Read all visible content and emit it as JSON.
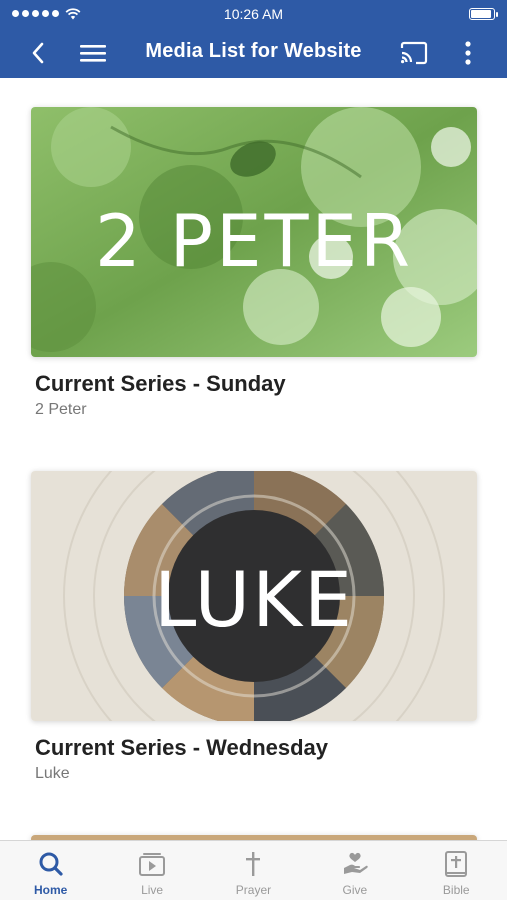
{
  "status": {
    "time": "10:26 AM"
  },
  "header": {
    "title": "Media List for Website"
  },
  "cards": [
    {
      "art_text": "2 PETER",
      "title": "Current Series - Sunday",
      "subtitle": "2 Peter"
    },
    {
      "art_text": "LUKE",
      "title": "Current Series - Wednesday",
      "subtitle": "Luke"
    }
  ],
  "tabs": [
    {
      "label": "Home",
      "icon": "search-icon",
      "active": true
    },
    {
      "label": "Live",
      "icon": "play-video-icon",
      "active": false
    },
    {
      "label": "Prayer",
      "icon": "cross-icon",
      "active": false
    },
    {
      "label": "Give",
      "icon": "giving-hand-icon",
      "active": false
    },
    {
      "label": "Bible",
      "icon": "bible-icon",
      "active": false
    }
  ],
  "colors": {
    "brand": "#2e5aa6",
    "tab_inactive": "#9a9a9a"
  }
}
